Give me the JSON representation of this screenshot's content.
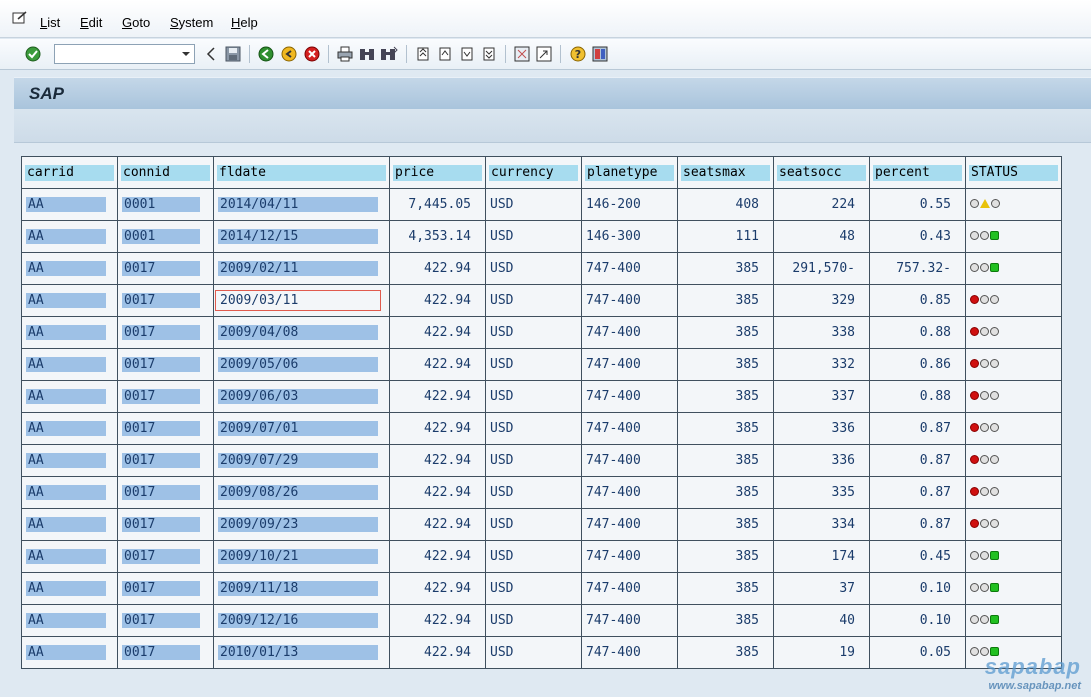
{
  "menu": {
    "items": [
      {
        "label": "List",
        "accel": "L",
        "rest": "ist"
      },
      {
        "label": "Edit",
        "accel": "E",
        "rest": "dit"
      },
      {
        "label": "Goto",
        "accel": "G",
        "rest": "oto"
      },
      {
        "label": "System",
        "accel": "S",
        "rest": "ystem"
      },
      {
        "label": "Help",
        "accel": "H",
        "rest": "elp"
      }
    ]
  },
  "toolbar": {
    "command_field_value": "",
    "icons": [
      "enter-icon",
      "back-arrow-icon",
      "save-icon",
      "back-icon",
      "exit-icon",
      "cancel-icon",
      "print-icon",
      "find-icon",
      "find-next-icon",
      "first-page-icon",
      "previous-page-icon",
      "next-page-icon",
      "last-page-icon",
      "create-session-icon",
      "shortcut-icon",
      "help-icon",
      "customize-layout-icon"
    ]
  },
  "title": "SAP",
  "table": {
    "headers": [
      "carrid",
      "connid",
      "fldate",
      "price",
      "currency",
      "planetype",
      "seatsmax",
      "seatsocc",
      "percent",
      "STATUS"
    ],
    "rows": [
      {
        "carrid": "AA",
        "connid": "0001",
        "fldate": "2014/04/11",
        "price": "7,445.05",
        "currency": "USD",
        "planetype": "146-200",
        "seatsmax": "408",
        "seatsocc": "224",
        "percent": "0.55",
        "status": "yellow"
      },
      {
        "carrid": "AA",
        "connid": "0001",
        "fldate": "2014/12/15",
        "price": "4,353.14",
        "currency": "USD",
        "planetype": "146-300",
        "seatsmax": "111",
        "seatsocc": "48",
        "percent": "0.43",
        "status": "green"
      },
      {
        "carrid": "AA",
        "connid": "0017",
        "fldate": "2009/02/11",
        "price": "422.94",
        "currency": "USD",
        "planetype": "747-400",
        "seatsmax": "385",
        "seatsocc": "291,570-",
        "percent": "757.32-",
        "status": "green"
      },
      {
        "carrid": "AA",
        "connid": "0017",
        "fldate": "2009/03/11",
        "price": "422.94",
        "currency": "USD",
        "planetype": "747-400",
        "seatsmax": "385",
        "seatsocc": "329",
        "percent": "0.85",
        "status": "red"
      },
      {
        "carrid": "AA",
        "connid": "0017",
        "fldate": "2009/04/08",
        "price": "422.94",
        "currency": "USD",
        "planetype": "747-400",
        "seatsmax": "385",
        "seatsocc": "338",
        "percent": "0.88",
        "status": "red"
      },
      {
        "carrid": "AA",
        "connid": "0017",
        "fldate": "2009/05/06",
        "price": "422.94",
        "currency": "USD",
        "planetype": "747-400",
        "seatsmax": "385",
        "seatsocc": "332",
        "percent": "0.86",
        "status": "red"
      },
      {
        "carrid": "AA",
        "connid": "0017",
        "fldate": "2009/06/03",
        "price": "422.94",
        "currency": "USD",
        "planetype": "747-400",
        "seatsmax": "385",
        "seatsocc": "337",
        "percent": "0.88",
        "status": "red"
      },
      {
        "carrid": "AA",
        "connid": "0017",
        "fldate": "2009/07/01",
        "price": "422.94",
        "currency": "USD",
        "planetype": "747-400",
        "seatsmax": "385",
        "seatsocc": "336",
        "percent": "0.87",
        "status": "red"
      },
      {
        "carrid": "AA",
        "connid": "0017",
        "fldate": "2009/07/29",
        "price": "422.94",
        "currency": "USD",
        "planetype": "747-400",
        "seatsmax": "385",
        "seatsocc": "336",
        "percent": "0.87",
        "status": "red"
      },
      {
        "carrid": "AA",
        "connid": "0017",
        "fldate": "2009/08/26",
        "price": "422.94",
        "currency": "USD",
        "planetype": "747-400",
        "seatsmax": "385",
        "seatsocc": "335",
        "percent": "0.87",
        "status": "red"
      },
      {
        "carrid": "AA",
        "connid": "0017",
        "fldate": "2009/09/23",
        "price": "422.94",
        "currency": "USD",
        "planetype": "747-400",
        "seatsmax": "385",
        "seatsocc": "334",
        "percent": "0.87",
        "status": "red"
      },
      {
        "carrid": "AA",
        "connid": "0017",
        "fldate": "2009/10/21",
        "price": "422.94",
        "currency": "USD",
        "planetype": "747-400",
        "seatsmax": "385",
        "seatsocc": "174",
        "percent": "0.45",
        "status": "green"
      },
      {
        "carrid": "AA",
        "connid": "0017",
        "fldate": "2009/11/18",
        "price": "422.94",
        "currency": "USD",
        "planetype": "747-400",
        "seatsmax": "385",
        "seatsocc": "37",
        "percent": "0.10",
        "status": "green"
      },
      {
        "carrid": "AA",
        "connid": "0017",
        "fldate": "2009/12/16",
        "price": "422.94",
        "currency": "USD",
        "planetype": "747-400",
        "seatsmax": "385",
        "seatsocc": "40",
        "percent": "0.10",
        "status": "green"
      },
      {
        "carrid": "AA",
        "connid": "0017",
        "fldate": "2010/01/13",
        "price": "422.94",
        "currency": "USD",
        "planetype": "747-400",
        "seatsmax": "385",
        "seatsocc": "19",
        "percent": "0.05",
        "status": "green"
      }
    ]
  },
  "watermark": {
    "line1": "sapabap",
    "line2": "www.sapabap.net"
  }
}
